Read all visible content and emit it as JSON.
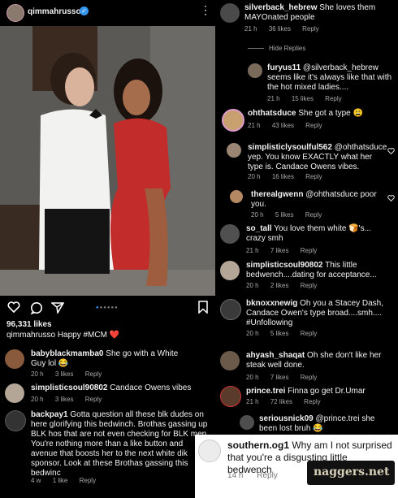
{
  "post": {
    "username": "qimmahrusso",
    "likes": "96,331 likes",
    "caption_user": "qimmahrusso",
    "caption_text": "Happy #MCM",
    "caption_emoji": "❤️"
  },
  "left_comments": [
    {
      "user": "babyblackmamba0",
      "text": "She go with a White Guy lol 😂",
      "time": "20 h",
      "likes": "3 likes",
      "reply": "Reply"
    },
    {
      "user": "simplisticsoul90802",
      "text": "Candace Owens vibes",
      "time": "20 h",
      "likes": "3 likes",
      "reply": "Reply"
    },
    {
      "user": "backpay1",
      "text": "Gotta question all these blk dudes on here glorifying this bedwinch. Brothas gassing up BLK hos that are not even checking for BLK men. You're nothing more than a like button and avenue that boosts her to the next white dik sponsor. Look at these Brothas gassing this bedwinc",
      "time": "4 w",
      "likes": "1 like",
      "reply": "Reply"
    }
  ],
  "right_comments": [
    {
      "user": "silverback_hebrew",
      "text": "She loves them MAYOnated people",
      "time": "21 h",
      "likes": "36 likes",
      "reply": "Reply"
    },
    {
      "hide_replies": "Hide Replies"
    },
    {
      "user": "furyus11",
      "text": "@silverback_hebrew seems like it's always like that with the hot mixed ladies....",
      "time": "21 h",
      "likes": "15 likes",
      "reply": "Reply"
    },
    {
      "user": "ohthatsduce",
      "text": "She got a type 😩",
      "time": "21 h",
      "likes": "43 likes",
      "reply": "Reply"
    },
    {
      "user": "simplisticlysoulful562",
      "text": "@ohthatsduce yep. You know EXACTLY what her type is. Candace Owens vibes.",
      "time": "20 h",
      "likes": "16 likes",
      "reply": "Reply"
    },
    {
      "user": "therealgwenn",
      "text": "@ohthatsduce poor you.",
      "time": "20 h",
      "likes": "5 likes",
      "reply": "Reply"
    },
    {
      "user": "so_tall",
      "text": "You love them white 🍞's... crazy smh",
      "time": "21 h",
      "likes": "7 likes",
      "reply": "Reply"
    },
    {
      "user": "simplisticsoul90802",
      "text": "This little bedwench....dating for acceptance...",
      "time": "20 h",
      "likes": "2 likes",
      "reply": "Reply"
    },
    {
      "user": "bknoxxnewig",
      "text": "Oh you a Stacey Dash, Candace Owen's type broad....smh.... #Unfollowing",
      "time": "20 h",
      "likes": "5 likes",
      "reply": "Reply"
    },
    {
      "user": "ahyash_shaqat",
      "text": "Oh she don't like her steak well done.",
      "time": "20 h",
      "likes": "7 likes",
      "reply": "Reply"
    },
    {
      "user": "prince.trei",
      "text": "Finna go get Dr.Umar",
      "time": "21 h",
      "likes": "72 likes",
      "reply": "Reply"
    },
    {
      "user": "seriousnick09",
      "text": "@prince.trei she been lost bruh 😂",
      "time": "",
      "likes": "",
      "reply": ""
    }
  ],
  "bottom_comment": {
    "user": "southern.og1",
    "text": "Why am I not surprised that you're a disgusting little bedwench",
    "time": "14 h",
    "reply": "Reply"
  },
  "watermark": "naggers.net"
}
